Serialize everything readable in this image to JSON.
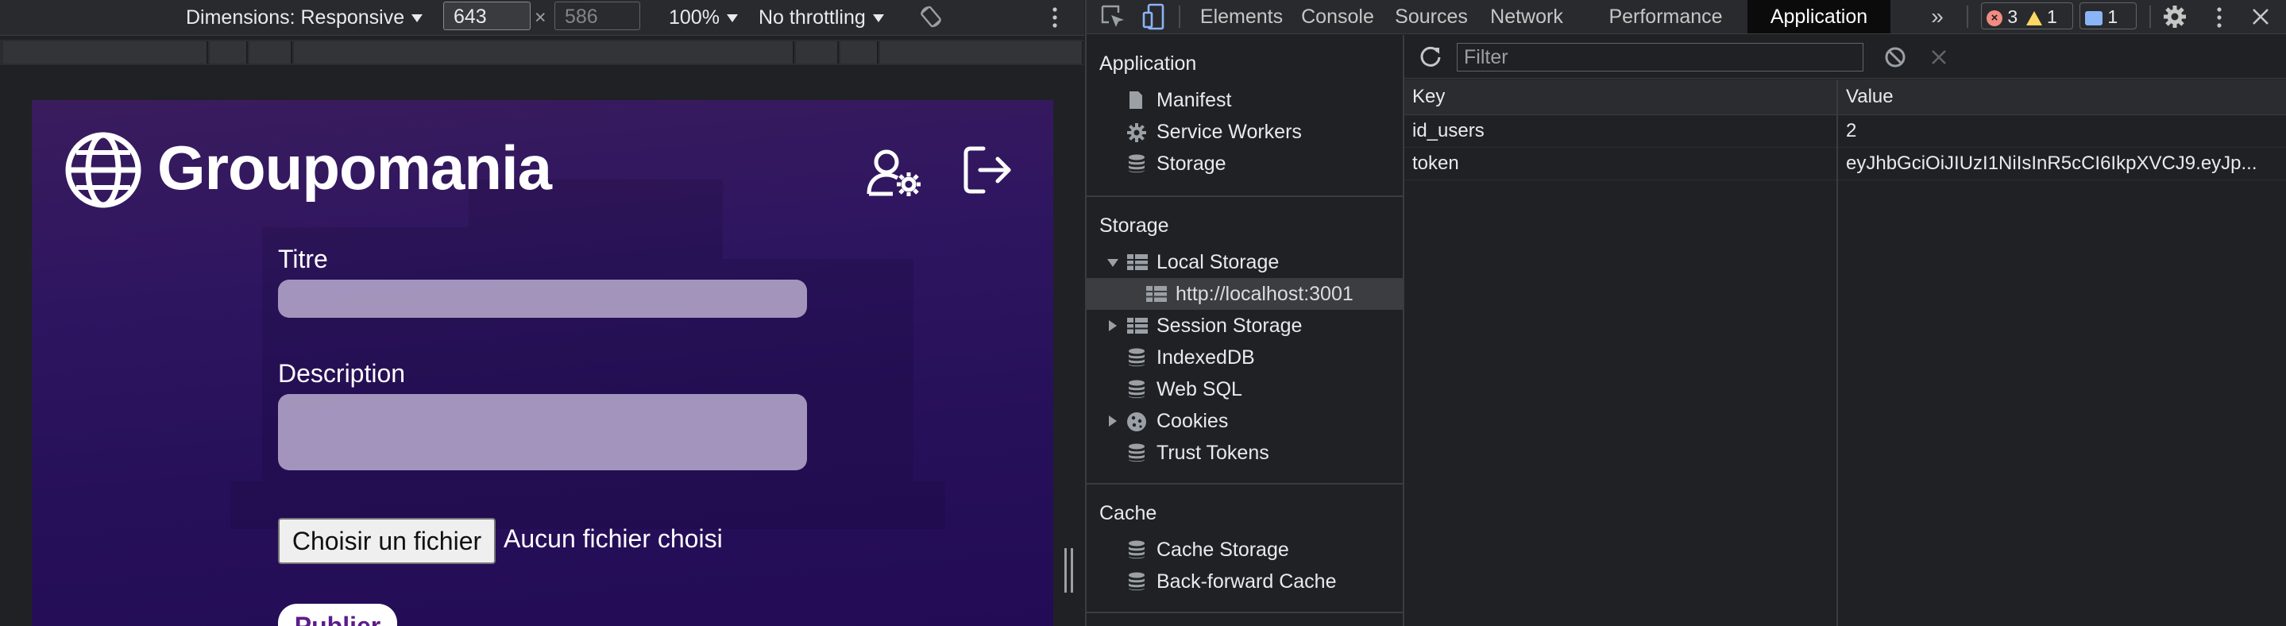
{
  "device_toolbar": {
    "dimensions_label": "Dimensions: Responsive",
    "width": "643",
    "height_placeholder": "586",
    "times": "×",
    "zoom": "100%",
    "throttling": "No throttling"
  },
  "page": {
    "brand": "Groupomania",
    "title_label": "Titre",
    "description_label": "Description",
    "file_button": "Choisir un fichier",
    "file_status": "Aucun fichier choisi",
    "publish_button": "Publier"
  },
  "devtools": {
    "tabs": [
      "Elements",
      "Console",
      "Sources",
      "Network",
      "Performance",
      "Application"
    ],
    "active_tab": "Application",
    "more_tabs": "»",
    "errors": "3",
    "warnings": "1",
    "messages": "1",
    "sidebar": {
      "application_header": "Application",
      "application_items": [
        "Manifest",
        "Service Workers",
        "Storage"
      ],
      "storage_header": "Storage",
      "local_storage": "Local Storage",
      "local_storage_origin": "http://localhost:3001",
      "storage_items": [
        "Session Storage",
        "IndexedDB",
        "Web SQL",
        "Cookies",
        "Trust Tokens"
      ],
      "cache_header": "Cache",
      "cache_items": [
        "Cache Storage",
        "Back-forward Cache"
      ]
    },
    "filter_placeholder": "Filter",
    "table": {
      "columns": [
        "Key",
        "Value"
      ],
      "rows": [
        {
          "key": "id_users",
          "value": "2"
        },
        {
          "key": "token",
          "value": "eyJhbGciOiJIUzI1NiIsInR5cCI6IkpXVCJ9.eyJp..."
        }
      ]
    },
    "colors": {
      "error": "#f28b82",
      "warning": "#fdd663",
      "message": "#8ab4f8",
      "accent": "#8ab4f8"
    }
  }
}
